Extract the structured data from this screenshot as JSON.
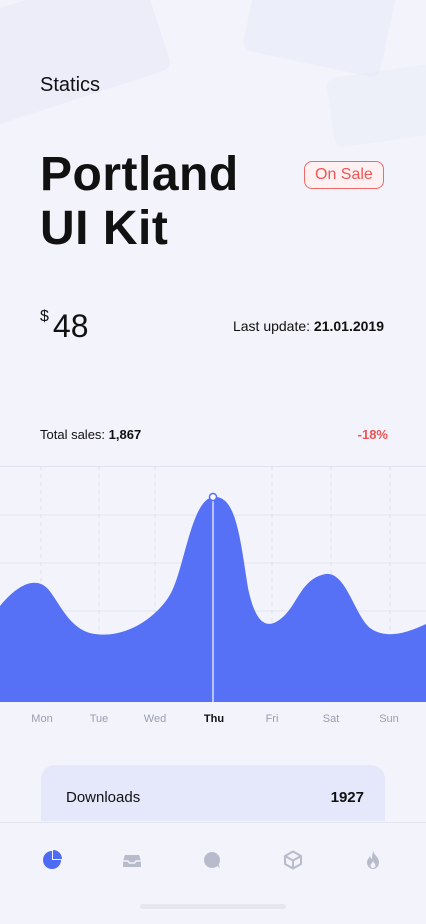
{
  "header": {
    "title": "Statics"
  },
  "product": {
    "name_line1": "Portland",
    "name_line2": "UI Kit",
    "badge": "On Sale",
    "currency": "$",
    "price": "48",
    "last_update_label": "Last update:",
    "last_update_value": "21.01.2019"
  },
  "sales": {
    "label": "Total sales:",
    "value": "1,867",
    "change": "-18%"
  },
  "chart_data": {
    "type": "area",
    "categories": [
      "Mon",
      "Tue",
      "Wed",
      "Thu",
      "Fri",
      "Sat",
      "Sun"
    ],
    "highlight": "Thu",
    "colors": {
      "fill": "#5671f5",
      "highlight_line": "#b9c3fb"
    }
  },
  "downloads": {
    "label": "Downloads",
    "value": "1927"
  },
  "tabbar": {
    "items": [
      {
        "icon": "pie-chart-icon",
        "active": true
      },
      {
        "icon": "inbox-icon",
        "active": false
      },
      {
        "icon": "chat-bubble-icon",
        "active": false
      },
      {
        "icon": "box-icon",
        "active": false
      },
      {
        "icon": "flame-icon",
        "active": false
      }
    ],
    "colors": {
      "active": "#4d6bf5",
      "inactive": "#b8bbcb"
    }
  }
}
